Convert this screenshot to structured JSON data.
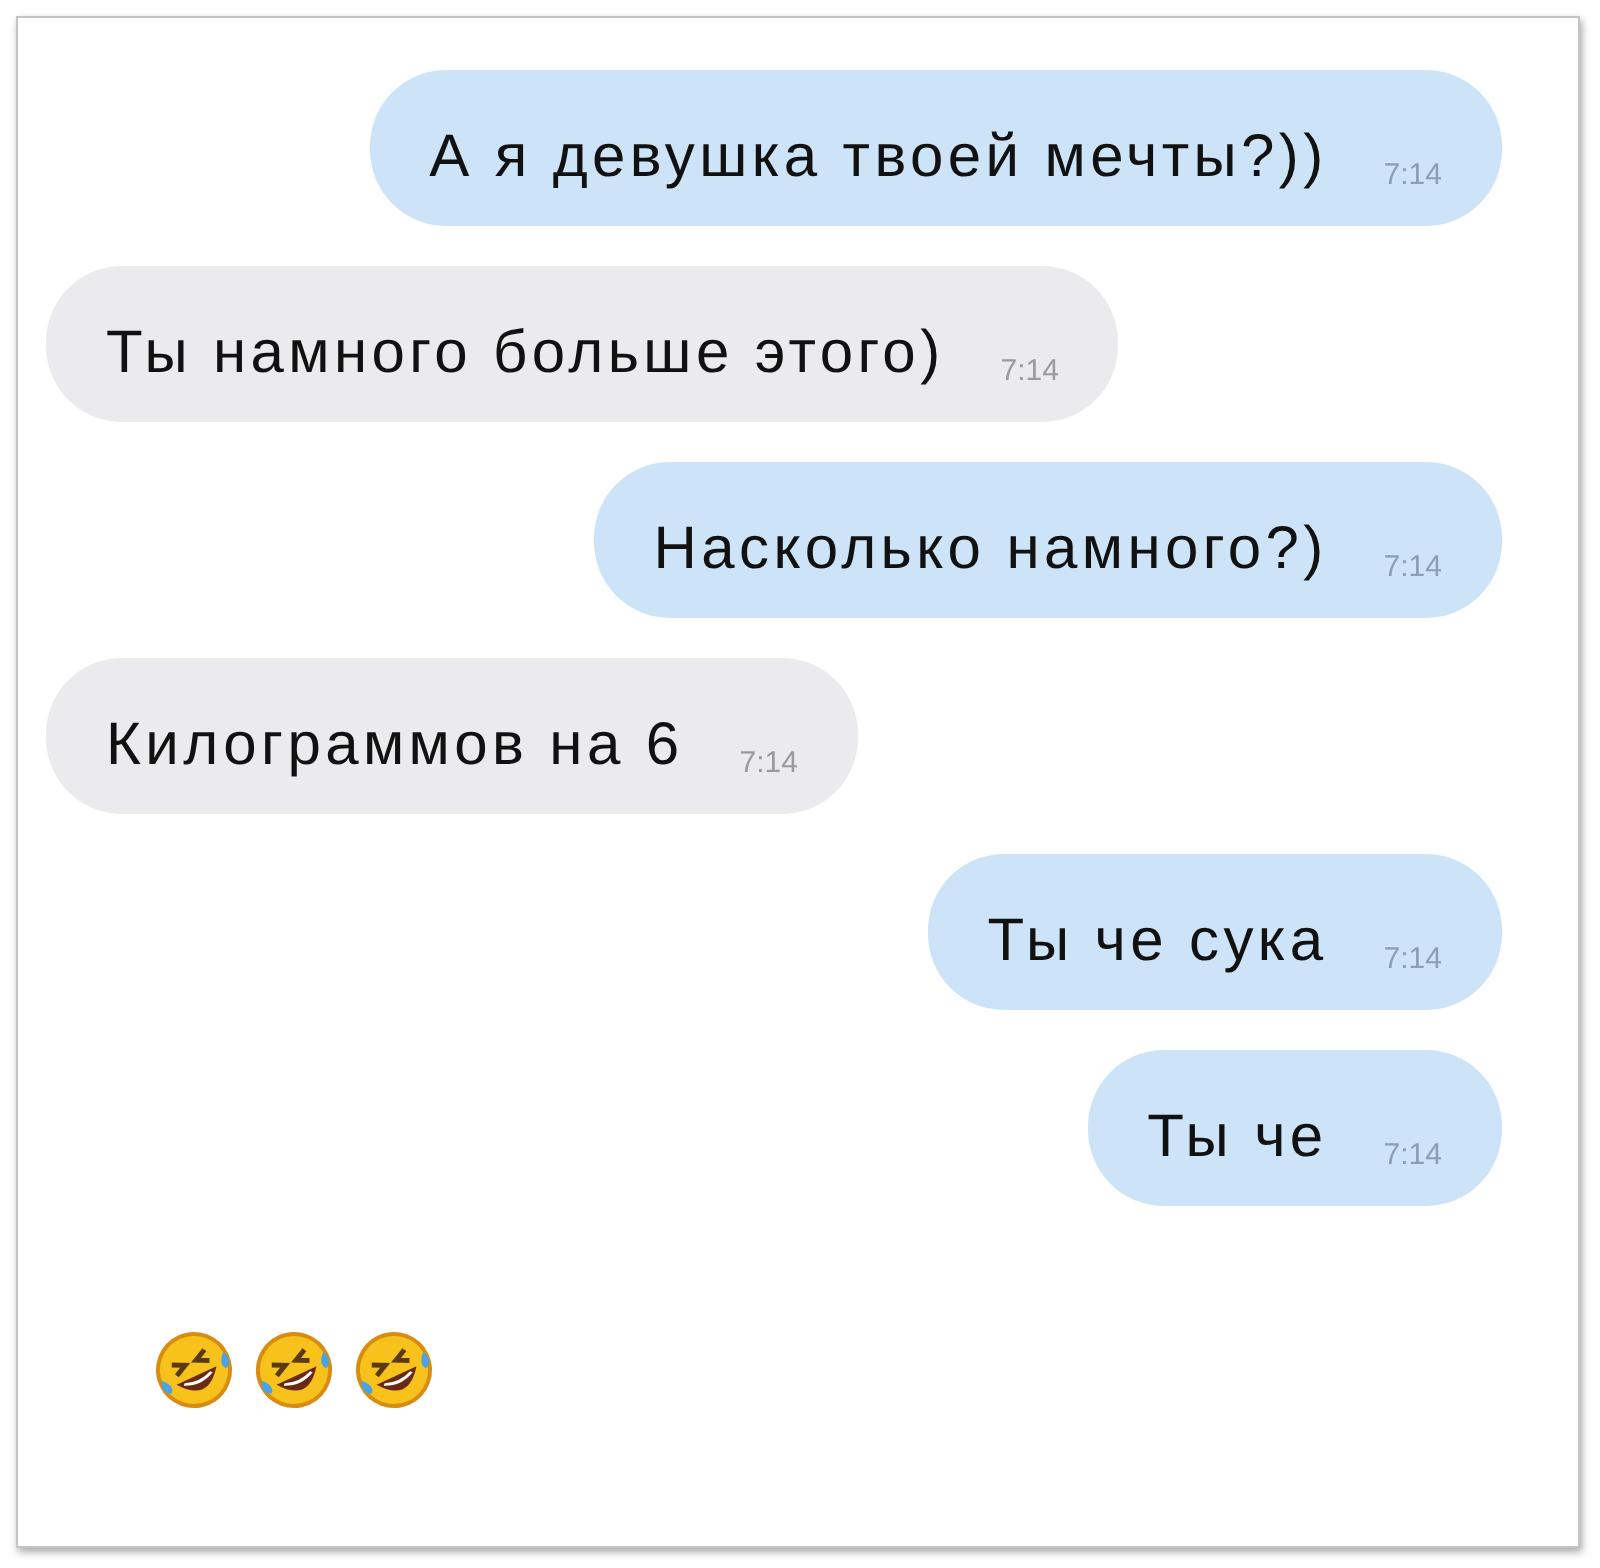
{
  "messages": [
    {
      "outgoing": true,
      "text": "А я девушка твоей мечты?))",
      "time": "7:14"
    },
    {
      "outgoing": false,
      "text": "Ты намного больше этого)",
      "time": "7:14"
    },
    {
      "outgoing": true,
      "text": "Насколько намного?)",
      "time": "7:14"
    },
    {
      "outgoing": false,
      "text": "Килограммов на 6",
      "time": "7:14"
    },
    {
      "outgoing": true,
      "text": "Ты че сука",
      "time": "7:14"
    },
    {
      "outgoing": true,
      "text": "Ты че",
      "time": "7:14"
    }
  ],
  "reactions": [
    {
      "kind": "laughing"
    },
    {
      "kind": "laughing"
    },
    {
      "kind": "laughing"
    }
  ]
}
